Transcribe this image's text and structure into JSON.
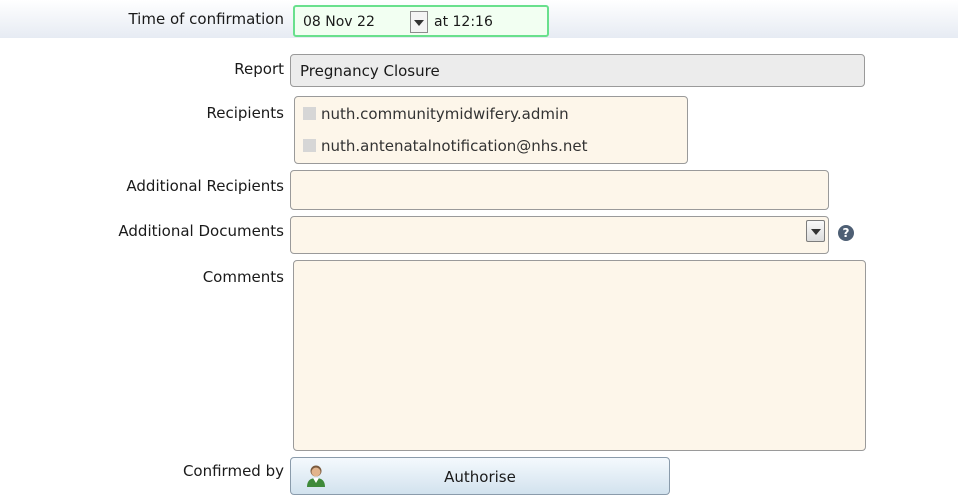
{
  "confirmation": {
    "label": "Time of confirmation",
    "date": "08 Nov 22",
    "time": "at 12:16"
  },
  "report": {
    "label": "Report",
    "value": "Pregnancy Closure"
  },
  "recipients": {
    "label": "Recipients",
    "items": [
      "nuth.communitymidwifery.admin",
      "nuth.antenatalnotification@nhs.net"
    ]
  },
  "additional_recipients": {
    "label": "Additional Recipients",
    "value": ""
  },
  "additional_documents": {
    "label": "Additional Documents",
    "value": "",
    "help_icon": "question-circle-icon"
  },
  "comments": {
    "label": "Comments",
    "value": ""
  },
  "confirmed_by": {
    "label": "Confirmed by",
    "button_label": "Authorise",
    "button_icon": "user-icon"
  },
  "colors": {
    "date_border": "#69e08d",
    "field_bg": "#fdf6ea",
    "report_bg": "#ececec",
    "button_bg": "#d2e2ee"
  }
}
